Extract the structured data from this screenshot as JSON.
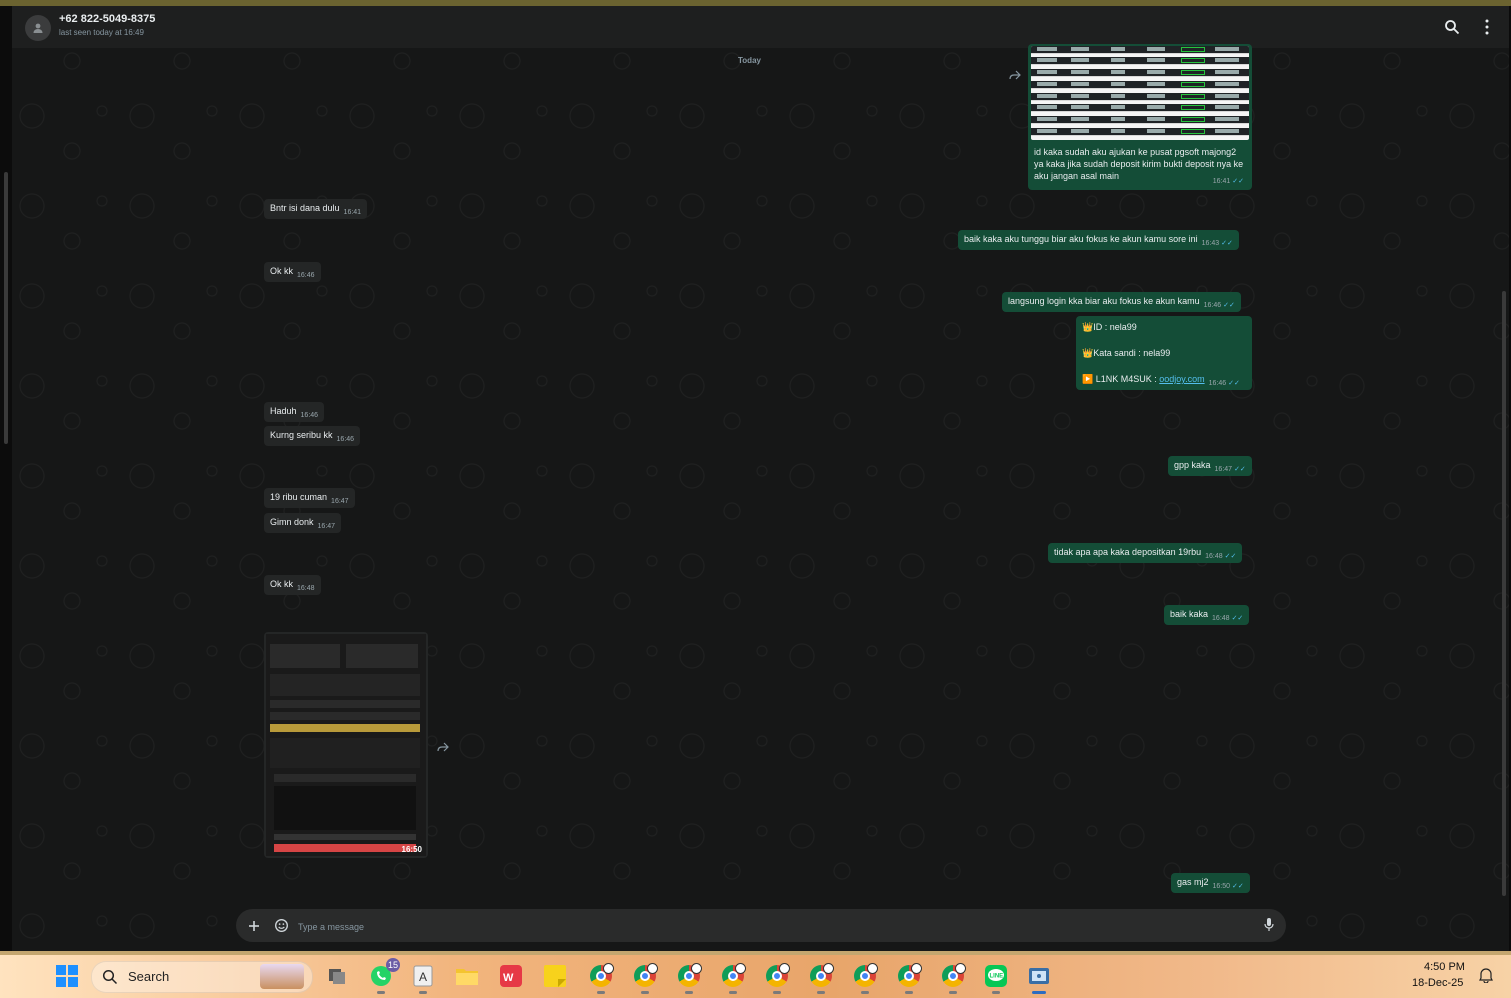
{
  "header": {
    "contact_name": "+62 822-5049-8375",
    "last_seen": "last seen today at 16:49"
  },
  "day_label": "Today",
  "image_message_top": {
    "caption": "id kaka sudah aku ajukan ke pusat pgsoft majong2 ya kaka jika sudah deposit kirim bukti deposit nya ke aku jangan asal main",
    "time": "16:41"
  },
  "messages": [
    {
      "text": "Bntr isi dana dulu",
      "time": "16:41"
    },
    {
      "text": "baik kaka aku tunggu biar aku fokus ke akun kamu sore ini",
      "time": "16:43"
    },
    {
      "text": "Ok kk",
      "time": "16:46"
    },
    {
      "text": "langsung login kka biar aku fokus ke akun kamu",
      "time": "16:46"
    },
    {
      "text": "Haduh",
      "time": "16:46"
    },
    {
      "text": "Kurng seribu kk",
      "time": "16:46"
    },
    {
      "text": "gpp kaka",
      "time": "16:47"
    },
    {
      "text": "19 ribu cuman",
      "time": "16:47"
    },
    {
      "text": "Gimn donk",
      "time": "16:47"
    },
    {
      "text": "tidak apa apa kaka depositkan 19rbu",
      "time": "16:48"
    },
    {
      "text": "Ok kk",
      "time": "16:48"
    },
    {
      "text": "baik kaka",
      "time": "16:48"
    },
    {
      "text": "gas mj2",
      "time": "16:50"
    }
  ],
  "credentials_message": {
    "id_line": "👑ID :  nela99",
    "password_line": "👑Kata sandi : nela99",
    "link_label": "▶️ L1NK M4SUK : ",
    "link_text": "oodjoy.com",
    "time": "16:46"
  },
  "image_message_bottom": {
    "time": "16:50"
  },
  "composer": {
    "placeholder": "Type a message"
  },
  "taskbar": {
    "search_label": "Search",
    "whatsapp_badge": "15",
    "time": "4:50 PM",
    "date": "18-Dec-25",
    "line_label": "LINE"
  },
  "colors": {
    "incoming_bubble": "#242626",
    "outgoing_bubble": "#144d37",
    "read_ticks": "#53bdeb"
  }
}
